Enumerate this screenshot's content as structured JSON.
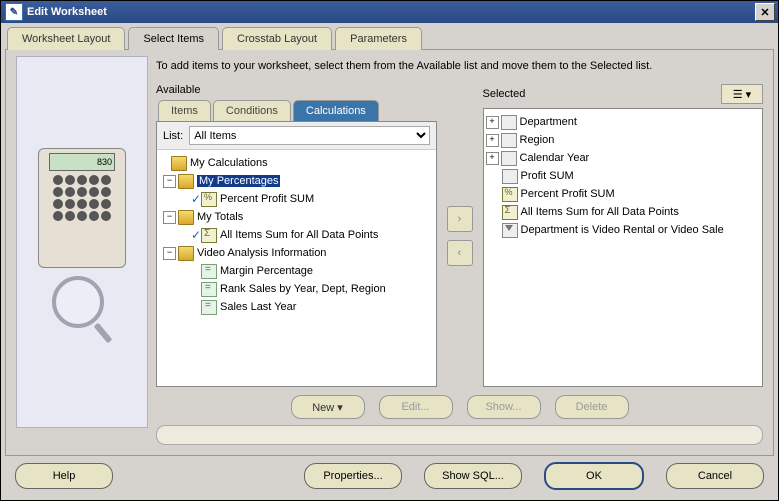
{
  "title": "Edit Worksheet",
  "closeGlyph": "✕",
  "tabs": [
    "Worksheet Layout",
    "Select Items",
    "Crosstab Layout",
    "Parameters"
  ],
  "activeTab": 1,
  "instruction": "To add items to your worksheet, select them from the Available list and move them to the Selected list.",
  "availableLabel": "Available",
  "selectedLabel": "Selected",
  "innerTabs": [
    "Items",
    "Conditions",
    "Calculations"
  ],
  "activeInnerTab": 2,
  "listLabel": "List:",
  "listSelected": "All Items",
  "calc_display": "830",
  "tree": {
    "myCalculations": "My Calculations",
    "myPercentages": "My Percentages",
    "percentProfitSum": "Percent Profit SUM",
    "myTotals": "My Totals",
    "allItemsSum": "All Items Sum for All Data Points",
    "videoAnalysis": "Video Analysis Information",
    "marginPct": "Margin Percentage",
    "rankSales": "Rank Sales by Year, Dept, Region",
    "salesLastYear": "Sales Last Year"
  },
  "selectedTree": {
    "department": "Department",
    "region": "Region",
    "calYear": "Calendar Year",
    "profitSum": "Profit SUM",
    "pctProfitSum": "Percent Profit SUM",
    "allItemsSum": "All Items Sum for All Data Points",
    "filter": "Department is Video Rental or Video Sale"
  },
  "moveRight": "›",
  "moveLeft": "‹",
  "actions": {
    "new": "New ▾",
    "edit": "Edit...",
    "show": "Show...",
    "delete": "Delete"
  },
  "bottom": {
    "help": "Help",
    "properties": "Properties...",
    "showSql": "Show SQL...",
    "ok": "OK",
    "cancel": "Cancel"
  }
}
